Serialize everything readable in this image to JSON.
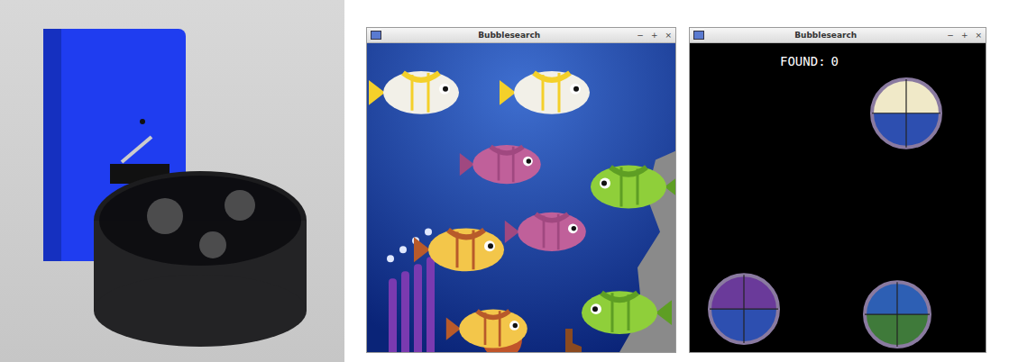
{
  "windows": [
    {
      "title": "Bubblesearch",
      "controls": [
        "−",
        "+",
        "×"
      ],
      "kind": "scene"
    },
    {
      "title": "Bubblesearch",
      "controls": [
        "−",
        "+",
        "×"
      ],
      "kind": "search",
      "hud": {
        "label": "FOUND:",
        "count": "0"
      }
    }
  ]
}
